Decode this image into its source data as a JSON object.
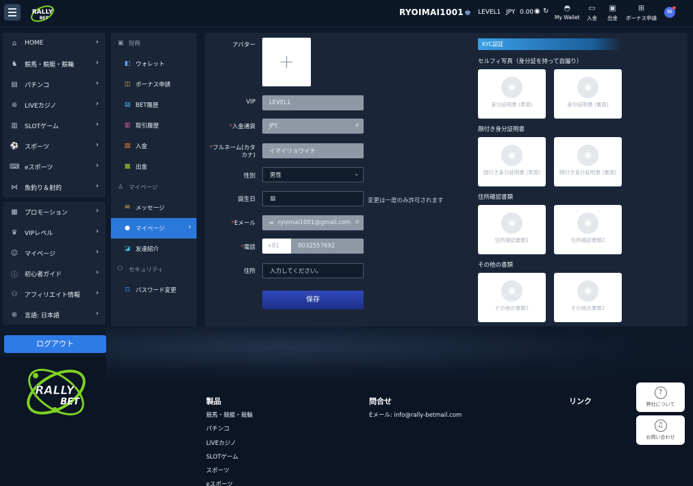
{
  "header": {
    "username": "RYOIMAI1001",
    "level": "LEVEL1",
    "currency": "JPY",
    "balance": "0.00",
    "buttons": [
      {
        "label": "My Wallet",
        "icon": "wallet-icon"
      },
      {
        "label": "入金",
        "icon": "deposit-icon"
      },
      {
        "label": "出金",
        "icon": "withdraw-icon"
      },
      {
        "label": "ボーナス申請",
        "icon": "bonus-icon"
      }
    ],
    "logo_text": "RALLY BET"
  },
  "sidebar": {
    "group1": [
      "HOME",
      "競馬・競艇・競輪",
      "パチンコ",
      "LIVEカジノ",
      "SLOTゲーム",
      "スポーツ",
      "eスポーツ",
      "魚釣り＆射的"
    ],
    "group2": [
      "プロモーション",
      "VIPレベル",
      "マイページ",
      "初心者ガイド",
      "アフィリエイト情報",
      "言語: 日本語"
    ],
    "logout": "ログアウト"
  },
  "submenu": {
    "finance_title": "財務",
    "finance_items": [
      "ウォレット",
      "ボーナス申請",
      "BET履歴",
      "取引履歴",
      "入金",
      "出金"
    ],
    "mypage_title": "マイページ",
    "mypage_items": [
      "メッセージ",
      "マイページ",
      "友達紹介"
    ],
    "security_title": "セキュリティ",
    "security_items": [
      "パスワード変更"
    ]
  },
  "form": {
    "avatar_label": "アバター",
    "vip_label": "VIP",
    "vip_value": "LEVEL1",
    "currency_label": "入金通貨",
    "currency_value": "JPY",
    "fullname_label": "フルネーム(カタカナ)",
    "fullname_value": "イマイリョウイチ",
    "gender_label": "性別",
    "gender_value": "男性",
    "birthday_label": "誕生日",
    "birthday_note": "変更は一度のみ許可されます",
    "email_label": "Eメール",
    "email_value": "ryoimai1001@gmail.com",
    "phone_label": "電話",
    "phone_prefix": "+81",
    "phone_value": "8032557692",
    "address_label": "住所",
    "address_placeholder": "入力してください。",
    "save_label": "保存"
  },
  "kyc": {
    "title": "KYC認証",
    "selfie_title": "セルフィ写真（身分証を持って自撮り）",
    "selfie_cards": [
      "身分証明書 (表面)",
      "身分証明書 (裏面)"
    ],
    "face_title": "顔付き身分証明書",
    "face_cards": [
      "顔付き身分証明書 (表面)",
      "顔付き身分証明書 (裏面)"
    ],
    "address_title": "住所確認書類",
    "address_cards": [
      "住所確認書類1",
      "住所確認書類2"
    ],
    "other_title": "その他の書類",
    "other_cards": [
      "その他の書類1",
      "その他の書類2"
    ]
  },
  "footer": {
    "products_title": "製品",
    "products": [
      "競馬・競艇・競輪",
      "パチンコ",
      "LIVEカジノ",
      "SLOTゲーム",
      "スポーツ",
      "eスポーツ"
    ],
    "contact_title": "問合せ",
    "contact_email": "Eメール:  info@rally-betmail.com",
    "links_title": "リンク",
    "about_label": "弊社について",
    "inquiry_label": "お問い合わせ"
  },
  "colors": {
    "accent": "#2a78da",
    "background": "#0e1b2c",
    "panel": "#1a2638",
    "required": "#e5484d"
  }
}
